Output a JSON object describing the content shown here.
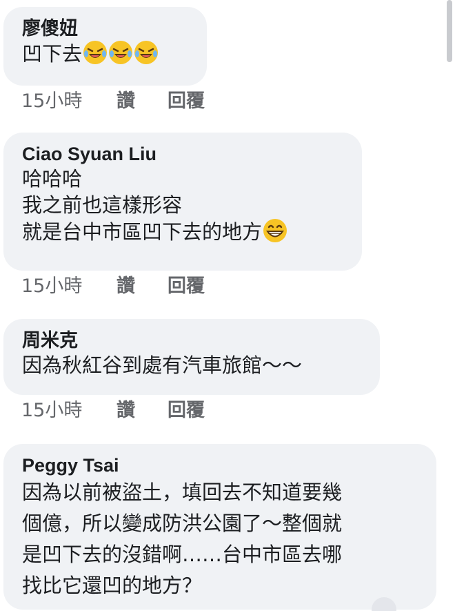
{
  "comments": [
    {
      "author": "廖傻妞",
      "lines": [
        "凹下去"
      ],
      "emojis": [
        "laughing-tears-emoji",
        "laughing-tears-emoji",
        "laughing-tears-emoji"
      ],
      "time": "15小時",
      "like": "讚",
      "reply": "回覆"
    },
    {
      "author": "Ciao Syuan Liu",
      "lines": [
        "哈哈哈",
        "我之前也這樣形容",
        "就是台中市區凹下去的地方"
      ],
      "emojis": [
        "grinning-emoji"
      ],
      "time": "15小時",
      "like": "讚",
      "reply": "回覆"
    },
    {
      "author": "周米克",
      "lines": [
        "因為秋紅谷到處有汽車旅館～～"
      ],
      "time": "15小時",
      "like": "讚",
      "reply": "回覆"
    },
    {
      "author": "Peggy Tsai",
      "lines": [
        "因為以前被盜土，填回去不知道要幾",
        "個億，所以變成防洪公園了～整個就",
        "是凹下去的沒錯啊……台中市區去哪",
        "找比它還凹的地方？"
      ]
    }
  ],
  "colors": {
    "bubble": "#f0f2f5",
    "meta_text": "#65676b",
    "emoji_yellow": "#f7c425"
  }
}
